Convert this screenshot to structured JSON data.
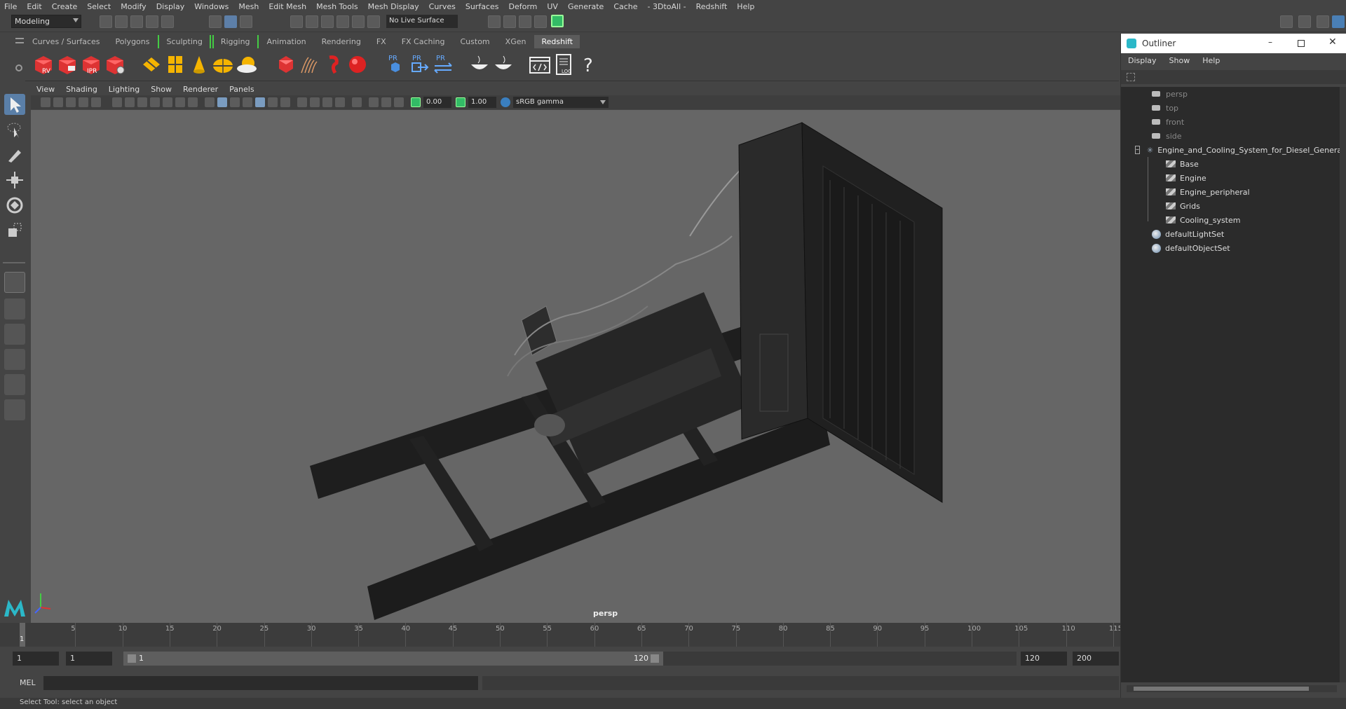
{
  "menubar": [
    "File",
    "Edit",
    "Create",
    "Select",
    "Modify",
    "Display",
    "Windows",
    "Mesh",
    "Edit Mesh",
    "Mesh Tools",
    "Mesh Display",
    "Curves",
    "Surfaces",
    "Deform",
    "UV",
    "Generate",
    "Cache",
    "- 3DtoAll -",
    "Redshift",
    "Help"
  ],
  "toolbar": {
    "mode": "Modeling",
    "live_surface": "No Live Surface"
  },
  "shelf_tabs": [
    "Curves / Surfaces",
    "Polygons",
    "Sculpting",
    "Rigging",
    "Animation",
    "Rendering",
    "FX",
    "FX Caching",
    "Custom",
    "XGen",
    "Redshift"
  ],
  "shelf_selected": "Redshift",
  "shelf_labels": {
    "rv": "RV",
    "ipr": "IPR",
    "pr1": "PR",
    "pr2": "PR",
    "pr3": "PR",
    "log": "LOG",
    "help": "?"
  },
  "panel_menu": [
    "View",
    "Shading",
    "Lighting",
    "Show",
    "Renderer",
    "Panels"
  ],
  "viewport": {
    "exposure": "0.00",
    "gamma": "1.00",
    "color_space": "sRGB gamma",
    "camera_label": "persp"
  },
  "timeline": {
    "ticks": [
      "5",
      "10",
      "15",
      "20",
      "25",
      "30",
      "35",
      "40",
      "45",
      "50",
      "55",
      "60",
      "65",
      "70",
      "75",
      "80",
      "85",
      "90",
      "95",
      "100",
      "105",
      "110",
      "115"
    ],
    "current_frame": "1"
  },
  "range": {
    "start": "1",
    "playback_start": "1",
    "slider_start": "1",
    "slider_end": "120",
    "playback_end": "120",
    "end": "200"
  },
  "cmdline": {
    "label": "MEL"
  },
  "status": "Select Tool: select an object",
  "outliner": {
    "title": "Outliner",
    "menu": [
      "Display",
      "Show",
      "Help"
    ],
    "cameras": [
      "persp",
      "top",
      "front",
      "side"
    ],
    "group": "Engine_and_Cooling_System_for_Diesel_Generat",
    "children": [
      "Base",
      "Engine",
      "Engine_peripheral",
      "Grids",
      "Cooling_system"
    ],
    "sets": [
      "defaultLightSet",
      "defaultObjectSet"
    ]
  }
}
